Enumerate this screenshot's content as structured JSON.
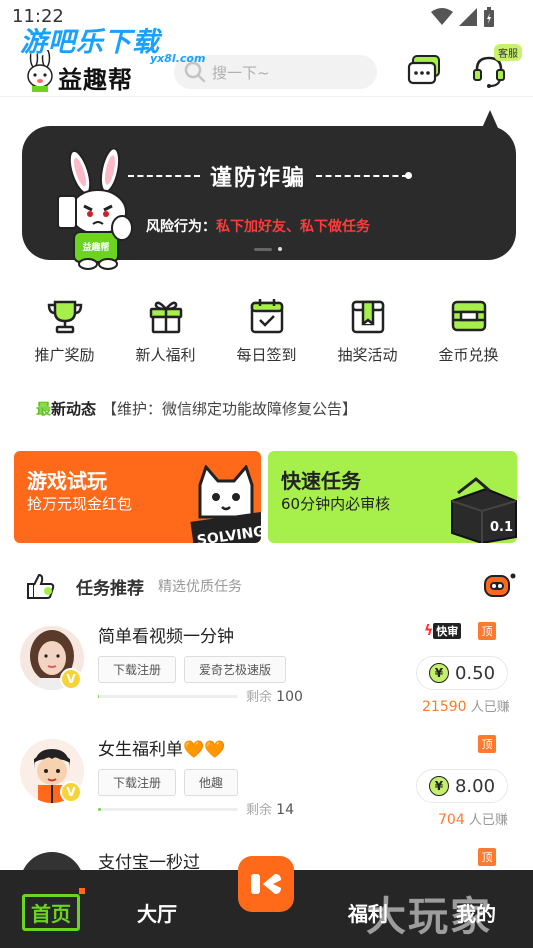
{
  "status_bar": {
    "time": "11:22"
  },
  "watermark": {
    "text": "游吧乐下载",
    "sub": "yx8l.com"
  },
  "header": {
    "logo_text": "益趣帮",
    "search_placeholder": "搜一下~",
    "service_badge": "客服"
  },
  "banner": {
    "title": "谨防诈骗",
    "risk_label": "风险行为：",
    "risk_value": "私下加好友、私下做任务",
    "rabbit_shirt": "益趣帮"
  },
  "menu": {
    "items": [
      {
        "label": "推广奖励",
        "icon": "trophy-icon"
      },
      {
        "label": "新人福利",
        "icon": "gift-icon"
      },
      {
        "label": "每日签到",
        "icon": "calendar-check-icon"
      },
      {
        "label": "抽奖活动",
        "icon": "lottery-box-icon"
      },
      {
        "label": "金币兑换",
        "icon": "exchange-icon"
      }
    ]
  },
  "news": {
    "tag_a": "最",
    "tag_b": "新动态",
    "text": "【维护：微信绑定功能故障修复公告】"
  },
  "promos": [
    {
      "title": "游戏试玩",
      "subtitle": "抢万元现金红包",
      "art_text": "SOLVING"
    },
    {
      "title": "快速任务",
      "subtitle": "60分钟内必审核",
      "art_text": "0.1"
    }
  ],
  "section": {
    "title": "任务推荐",
    "subtitle": "精选优质任务"
  },
  "tasks": [
    {
      "name": "简单看视频一分钟",
      "tags": [
        "下载注册",
        "爱奇艺极速版"
      ],
      "remain_label": "剩余",
      "remain": "100",
      "progress": 0.0,
      "fast": "快审",
      "top": "顶",
      "reward": "0.50",
      "earned": "21590",
      "earned_label": "人已赚",
      "v": "V"
    },
    {
      "name": "女生福利单🧡🧡",
      "tags": [
        "下载注册",
        "他趣"
      ],
      "remain_label": "剩余",
      "remain": "14",
      "progress": 0.02,
      "top": "顶",
      "reward": "8.00",
      "earned": "704",
      "earned_label": "人已赚",
      "v": "V"
    },
    {
      "name": "支付宝一秒过",
      "top": "顶"
    }
  ],
  "tabbar": {
    "home": "首页",
    "hall": "大厅",
    "welfare": "福利",
    "mine": "我的"
  },
  "watermark2": {
    "text": "大玩家"
  },
  "colors": {
    "accent_green": "#6cd41f",
    "accent_orange": "#ff6a1a",
    "banner_bg": "#2b2b2b",
    "risk_red": "#ff3b3b"
  }
}
